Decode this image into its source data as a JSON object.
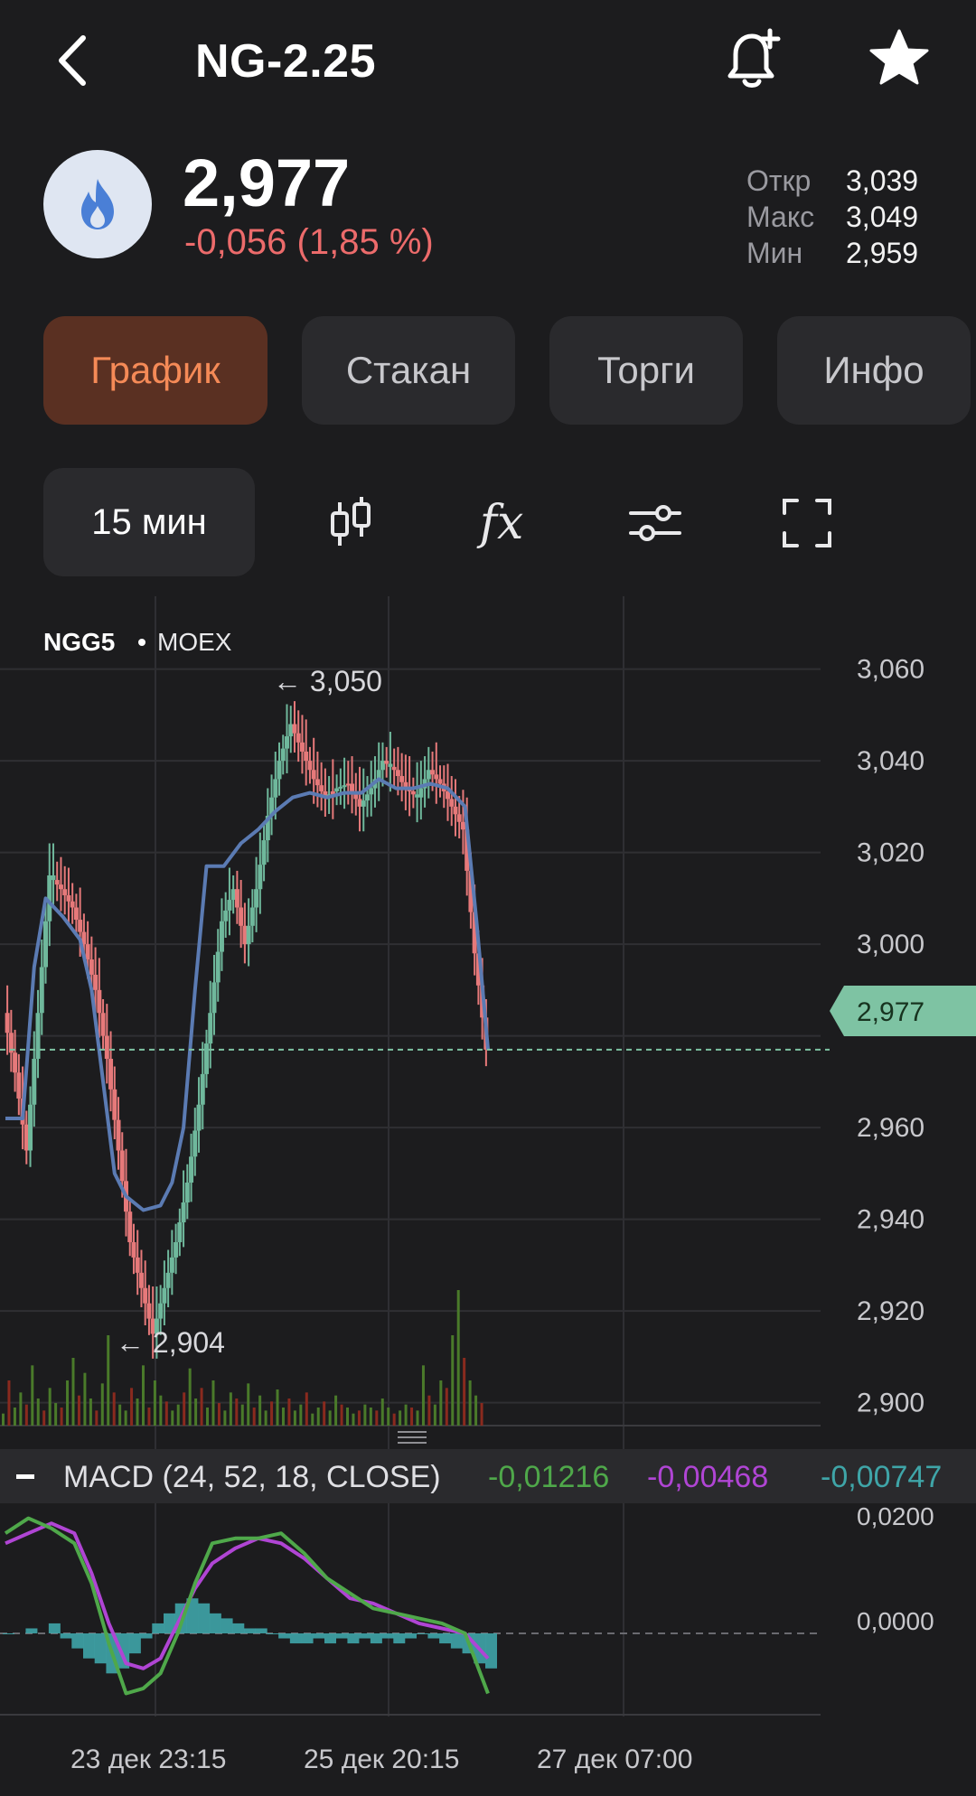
{
  "header": {
    "title": "NG-2.25",
    "icons": {
      "back": "chevron-left-icon",
      "alert": "bell-plus-icon",
      "favorite": "star-icon"
    }
  },
  "quote": {
    "logo_icon": "flame-icon",
    "price": "2,977",
    "change": "-0,056 (1,85 %)",
    "stats": [
      {
        "label": "Откр",
        "value": "3,039"
      },
      {
        "label": "Макс",
        "value": "3,049"
      },
      {
        "label": "Мин",
        "value": "2,959"
      }
    ]
  },
  "tabs": [
    {
      "label": "График",
      "active": true
    },
    {
      "label": "Стакан",
      "active": false
    },
    {
      "label": "Торги",
      "active": false
    },
    {
      "label": "Инфо",
      "active": false
    }
  ],
  "toolbar": {
    "interval": "15 мин",
    "icons": [
      "candles-icon",
      "fx-icon",
      "sliders-icon",
      "fullscreen-icon"
    ],
    "fx_symbol": "fx"
  },
  "colors": {
    "background": "#1c1c1e",
    "up": "#6fb89c",
    "down": "#e6797a",
    "ma_line": "#5b7bb3",
    "current_price_label": "#7ec3a3",
    "macd_line": "#4fa84a",
    "signal_line": "#b045d4",
    "histogram": "#3fa5a8"
  },
  "chart": {
    "ticker": "NGG5",
    "exchange": "MOEX",
    "current_price": "2,977",
    "high_marker": "← 3,050",
    "low_marker": "← 2,904",
    "price_ticks": [
      "3,060",
      "3,040",
      "3,020",
      "3,000",
      "2,960",
      "2,940",
      "2,920",
      "2,900"
    ],
    "x_ticks": [
      "23 дек 23:15",
      "25 дек 20:15",
      "27 дек 07:00"
    ],
    "macd": {
      "label": "MACD (24, 52, 18, CLOSE)",
      "macd_value": "-0,01216",
      "signal_value": "-0,00468",
      "hist_value": "-0,00747",
      "ticks": [
        "0,0200",
        "0,0000"
      ]
    }
  },
  "chart_data": {
    "type": "candlestick",
    "interval": "15 мин",
    "ylim": [
      2895,
      3068
    ],
    "price_points": [
      [
        0,
        2985
      ],
      [
        2,
        2972
      ],
      [
        4,
        2955
      ],
      [
        6,
        2985
      ],
      [
        8,
        3015
      ],
      [
        10,
        3012
      ],
      [
        12,
        3008
      ],
      [
        14,
        3000
      ],
      [
        16,
        2990
      ],
      [
        18,
        2975
      ],
      [
        20,
        2955
      ],
      [
        22,
        2935
      ],
      [
        24,
        2925
      ],
      [
        26,
        2915
      ],
      [
        28,
        2925
      ],
      [
        30,
        2935
      ],
      [
        32,
        2948
      ],
      [
        34,
        2965
      ],
      [
        36,
        2985
      ],
      [
        38,
        3005
      ],
      [
        40,
        3012
      ],
      [
        42,
        3000
      ],
      [
        44,
        3012
      ],
      [
        46,
        3028
      ],
      [
        48,
        3040
      ],
      [
        50,
        3048
      ],
      [
        52,
        3042
      ],
      [
        54,
        3036
      ],
      [
        56,
        3032
      ],
      [
        58,
        3034
      ],
      [
        60,
        3035
      ],
      [
        62,
        3030
      ],
      [
        64,
        3034
      ],
      [
        66,
        3040
      ],
      [
        68,
        3038
      ],
      [
        70,
        3034
      ],
      [
        72,
        3032
      ],
      [
        74,
        3038
      ],
      [
        76,
        3035
      ],
      [
        78,
        3030
      ],
      [
        80,
        3025
      ],
      [
        82,
        2998
      ],
      [
        84,
        2977
      ]
    ],
    "ma_points": [
      [
        0,
        2962
      ],
      [
        3,
        2962
      ],
      [
        5,
        2995
      ],
      [
        7,
        3010
      ],
      [
        10,
        3006
      ],
      [
        13,
        3001
      ],
      [
        15,
        2990
      ],
      [
        17,
        2970
      ],
      [
        19,
        2950
      ],
      [
        21,
        2945
      ],
      [
        24,
        2942
      ],
      [
        27,
        2943
      ],
      [
        29,
        2948
      ],
      [
        31,
        2960
      ],
      [
        33,
        2990
      ],
      [
        35,
        3017
      ],
      [
        38,
        3017
      ],
      [
        41,
        3022
      ],
      [
        44,
        3025
      ],
      [
        47,
        3029
      ],
      [
        50,
        3032
      ],
      [
        53,
        3033
      ],
      [
        56,
        3032
      ],
      [
        59,
        3033
      ],
      [
        62,
        3033
      ],
      [
        65,
        3036
      ],
      [
        68,
        3034
      ],
      [
        71,
        3034
      ],
      [
        74,
        3035
      ],
      [
        77,
        3034
      ],
      [
        80,
        3030
      ],
      [
        82,
        3005
      ],
      [
        84,
        2977
      ]
    ],
    "volume": [
      8,
      30,
      12,
      22,
      14,
      40,
      18,
      10,
      25,
      15,
      12,
      30,
      45,
      20,
      35,
      18,
      10,
      28,
      60,
      22,
      14,
      10,
      25,
      18,
      40,
      12,
      30,
      20,
      16,
      10,
      14,
      22,
      38,
      18,
      25,
      12,
      30,
      15,
      10,
      22,
      18,
      14,
      28,
      12,
      20,
      10,
      16,
      24,
      12,
      18,
      10,
      14,
      22,
      8,
      12,
      16,
      10,
      20,
      14,
      12,
      8,
      10,
      14,
      12,
      10,
      18,
      12,
      8,
      10,
      14,
      12,
      10,
      40,
      20,
      14,
      30,
      25,
      60,
      90,
      45,
      30,
      20,
      15
    ],
    "macd_series": {
      "macd": [
        [
          0,
          0.02
        ],
        [
          4,
          0.023
        ],
        [
          8,
          0.021
        ],
        [
          12,
          0.018
        ],
        [
          15,
          0.01
        ],
        [
          18,
          -0.002
        ],
        [
          21,
          -0.012
        ],
        [
          24,
          -0.011
        ],
        [
          27,
          -0.008
        ],
        [
          30,
          0.0
        ],
        [
          33,
          0.01
        ],
        [
          36,
          0.018
        ],
        [
          40,
          0.019
        ],
        [
          44,
          0.019
        ],
        [
          48,
          0.02
        ],
        [
          52,
          0.016
        ],
        [
          56,
          0.011
        ],
        [
          60,
          0.008
        ],
        [
          64,
          0.005
        ],
        [
          68,
          0.004
        ],
        [
          72,
          0.003
        ],
        [
          76,
          0.002
        ],
        [
          80,
          0.0
        ],
        [
          82,
          -0.006
        ],
        [
          84,
          -0.012
        ]
      ],
      "signal": [
        [
          0,
          0.018
        ],
        [
          4,
          0.02
        ],
        [
          8,
          0.022
        ],
        [
          12,
          0.02
        ],
        [
          15,
          0.012
        ],
        [
          18,
          0.002
        ],
        [
          21,
          -0.006
        ],
        [
          24,
          -0.007
        ],
        [
          27,
          -0.005
        ],
        [
          30,
          0.002
        ],
        [
          33,
          0.009
        ],
        [
          36,
          0.014
        ],
        [
          40,
          0.017
        ],
        [
          44,
          0.019
        ],
        [
          48,
          0.018
        ],
        [
          52,
          0.015
        ],
        [
          56,
          0.011
        ],
        [
          60,
          0.007
        ],
        [
          64,
          0.006
        ],
        [
          68,
          0.004
        ],
        [
          72,
          0.002
        ],
        [
          76,
          0.001
        ],
        [
          80,
          0.0
        ],
        [
          84,
          -0.005
        ]
      ],
      "histogram": [
        [
          0,
          0.0
        ],
        [
          4,
          0.001
        ],
        [
          8,
          0.002
        ],
        [
          10,
          -0.001
        ],
        [
          12,
          -0.003
        ],
        [
          14,
          -0.005
        ],
        [
          16,
          -0.006
        ],
        [
          18,
          -0.008
        ],
        [
          20,
          -0.007
        ],
        [
          22,
          -0.004
        ],
        [
          24,
          -0.001
        ],
        [
          26,
          0.002
        ],
        [
          28,
          0.004
        ],
        [
          30,
          0.006
        ],
        [
          32,
          0.007
        ],
        [
          34,
          0.006
        ],
        [
          36,
          0.004
        ],
        [
          38,
          0.003
        ],
        [
          40,
          0.002
        ],
        [
          42,
          0.001
        ],
        [
          44,
          0.001
        ],
        [
          46,
          0.0
        ],
        [
          48,
          -0.001
        ],
        [
          50,
          -0.002
        ],
        [
          52,
          -0.002
        ],
        [
          54,
          -0.001
        ],
        [
          56,
          -0.002
        ],
        [
          58,
          -0.001
        ],
        [
          60,
          -0.002
        ],
        [
          62,
          -0.001
        ],
        [
          64,
          -0.002
        ],
        [
          66,
          -0.001
        ],
        [
          68,
          -0.002
        ],
        [
          70,
          -0.001
        ],
        [
          72,
          0.0
        ],
        [
          74,
          -0.001
        ],
        [
          76,
          -0.002
        ],
        [
          78,
          -0.003
        ],
        [
          80,
          -0.004
        ],
        [
          82,
          -0.006
        ],
        [
          84,
          -0.007
        ]
      ],
      "ylim": [
        -0.013,
        0.026
      ]
    }
  }
}
